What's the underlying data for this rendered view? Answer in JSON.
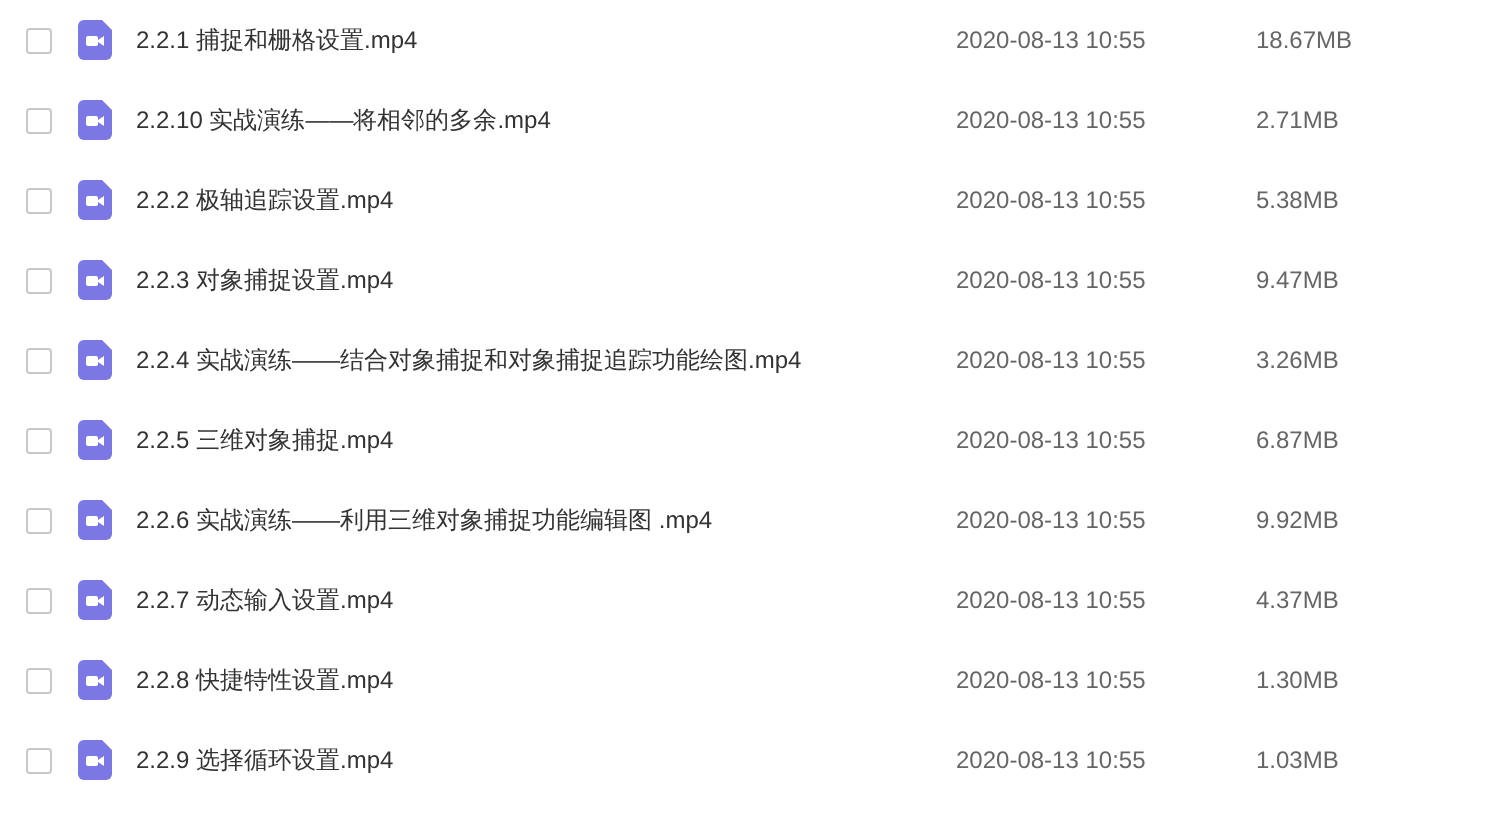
{
  "files": [
    {
      "name": "2.2.1 捕捉和栅格设置.mp4",
      "modified": "2020-08-13 10:55",
      "size": "18.67MB",
      "checked": false
    },
    {
      "name": "2.2.10 实战演练——将相邻的多余.mp4",
      "modified": "2020-08-13 10:55",
      "size": "2.71MB",
      "checked": false
    },
    {
      "name": "2.2.2 极轴追踪设置.mp4",
      "modified": "2020-08-13 10:55",
      "size": "5.38MB",
      "checked": false
    },
    {
      "name": "2.2.3 对象捕捉设置.mp4",
      "modified": "2020-08-13 10:55",
      "size": "9.47MB",
      "checked": false
    },
    {
      "name": "2.2.4 实战演练——结合对象捕捉和对象捕捉追踪功能绘图.mp4",
      "modified": "2020-08-13 10:55",
      "size": "3.26MB",
      "checked": false
    },
    {
      "name": "2.2.5 三维对象捕捉.mp4",
      "modified": "2020-08-13 10:55",
      "size": "6.87MB",
      "checked": false
    },
    {
      "name": "2.2.6 实战演练——利用三维对象捕捉功能编辑图 .mp4",
      "modified": "2020-08-13 10:55",
      "size": "9.92MB",
      "checked": false
    },
    {
      "name": "2.2.7 动态输入设置.mp4",
      "modified": "2020-08-13 10:55",
      "size": "4.37MB",
      "checked": false
    },
    {
      "name": "2.2.8 快捷特性设置.mp4",
      "modified": "2020-08-13 10:55",
      "size": "1.30MB",
      "checked": false
    },
    {
      "name": "2.2.9 选择循环设置.mp4",
      "modified": "2020-08-13 10:55",
      "size": "1.03MB",
      "checked": false
    }
  ]
}
